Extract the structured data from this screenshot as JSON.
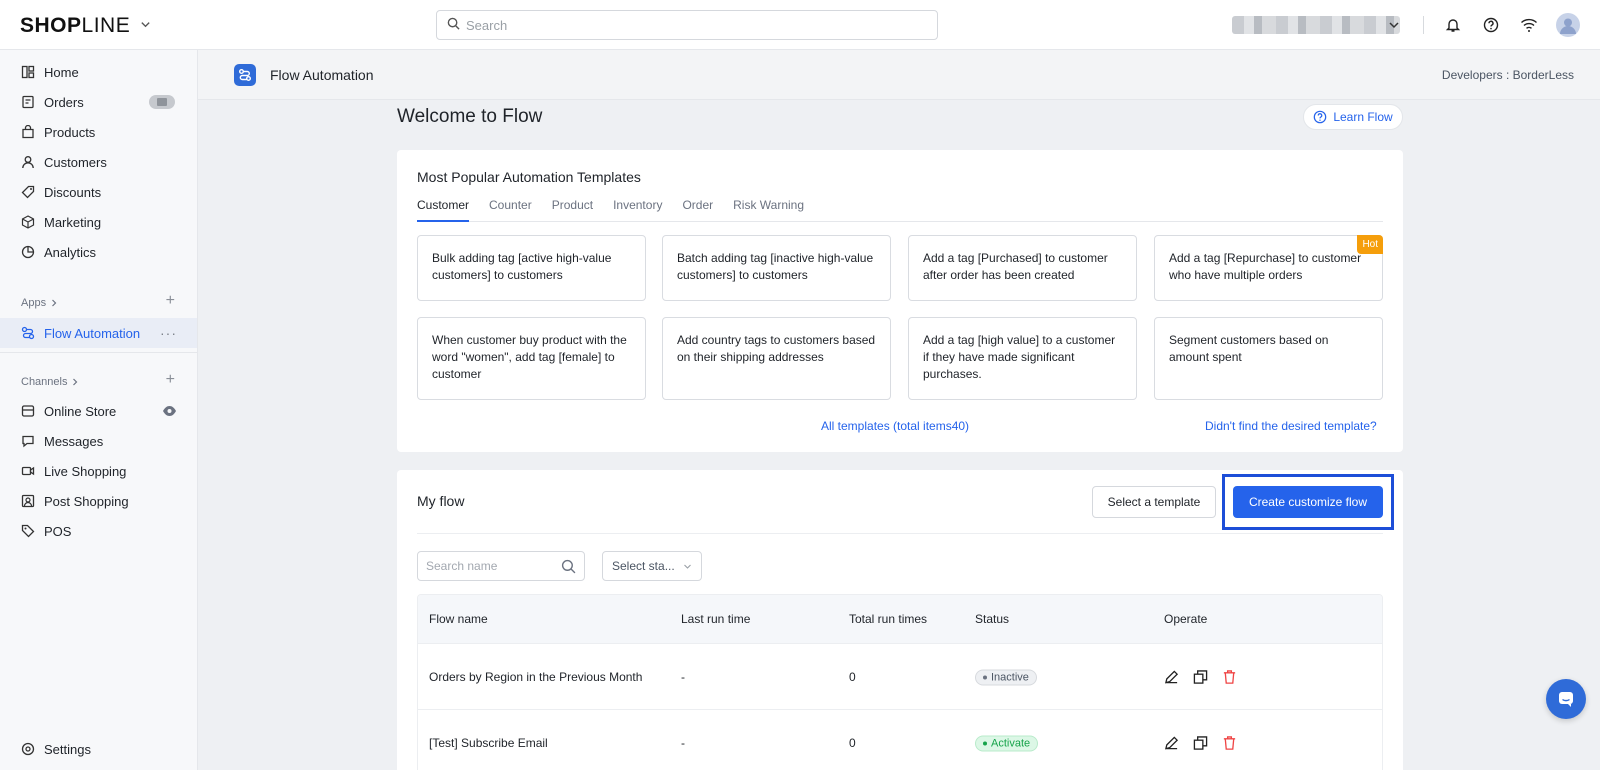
{
  "brand": {
    "logo_bold": "SHOP",
    "logo_thin": "LINE"
  },
  "search": {
    "placeholder": "Search"
  },
  "sidebar": {
    "items": [
      {
        "label": "Home"
      },
      {
        "label": "Orders"
      },
      {
        "label": "Products"
      },
      {
        "label": "Customers"
      },
      {
        "label": "Discounts"
      },
      {
        "label": "Marketing"
      },
      {
        "label": "Analytics"
      }
    ],
    "apps_label": "Apps",
    "apps": [
      {
        "label": "Flow Automation"
      }
    ],
    "channels_label": "Channels",
    "channels": [
      {
        "label": "Online Store"
      },
      {
        "label": "Messages"
      },
      {
        "label": "Live Shopping"
      },
      {
        "label": "Post Shopping"
      },
      {
        "label": "POS"
      }
    ],
    "settings_label": "Settings"
  },
  "page_header": {
    "title": "Flow Automation",
    "developer_info": "Developers : BorderLess"
  },
  "main": {
    "welcome": "Welcome to Flow",
    "learn_label": "Learn Flow",
    "templates": {
      "title": "Most Popular Automation Templates",
      "tabs": [
        "Customer",
        "Counter",
        "Product",
        "Inventory",
        "Order",
        "Risk Warning"
      ],
      "cards": [
        "Bulk adding tag [active high-value customers] to customers",
        "Batch adding tag [inactive high-value customers] to customers",
        "Add a tag [Purchased] to customer after order has been created",
        "Add a tag [Repurchase] to customer who have multiple orders",
        "When customer buy product with the word \"women\", add tag [female] to customer",
        "Add country tags to customers based on their shipping addresses",
        "Add a tag [high value] to a customer if they have made significant purchases.",
        "Segment customers based on amount spent"
      ],
      "hot_label": "Hot",
      "all_templates_link": "All templates (total items40)",
      "not_found_link": "Didn't find the desired template?"
    },
    "my_flow": {
      "title": "My flow",
      "select_template_label": "Select a template",
      "create_label": "Create customize flow",
      "search_placeholder": "Search name",
      "status_select": "Select sta...",
      "columns": [
        "Flow name",
        "Last run time",
        "Total run times",
        "Status",
        "Operate"
      ],
      "rows": [
        {
          "name": "Orders by Region in the Previous Month",
          "last_run": "-",
          "total_runs": "0",
          "status": "Inactive"
        },
        {
          "name": "[Test] Subscribe Email",
          "last_run": "-",
          "total_runs": "0",
          "status": "Activate"
        }
      ]
    }
  },
  "colors": {
    "accent": "#2563eb",
    "hot": "#f59e0b",
    "active_green": "#16a34a",
    "delete_red": "#ef4444"
  }
}
